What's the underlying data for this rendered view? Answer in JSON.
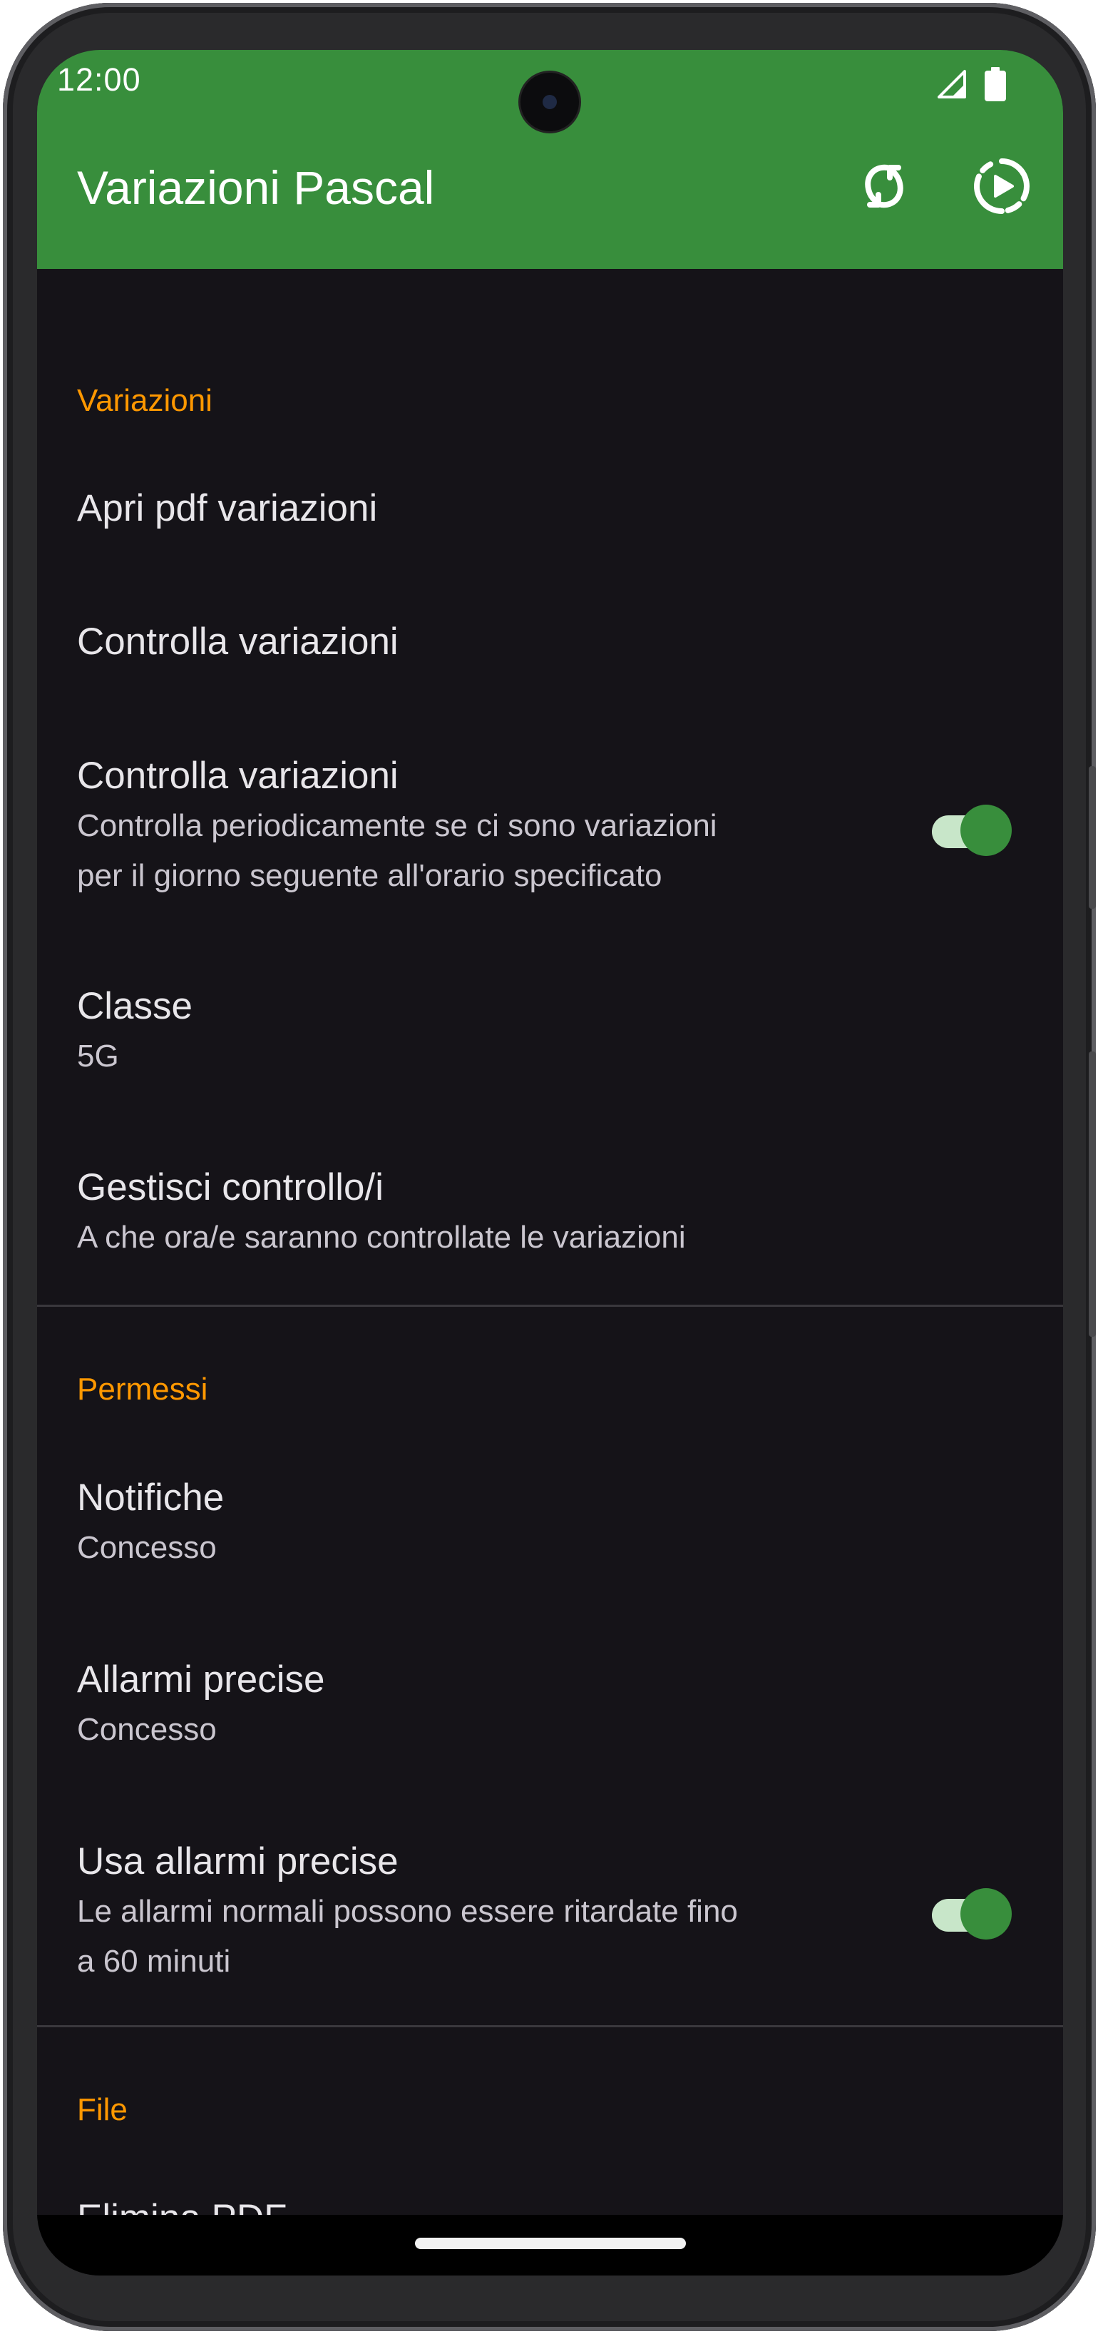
{
  "status_bar": {
    "time": "12:00"
  },
  "app_bar": {
    "title": "Variazioni Pascal",
    "actions": [
      {
        "icon": "sync-icon"
      },
      {
        "icon": "play-circle-dashed-icon"
      }
    ]
  },
  "colors": {
    "primary": "#388e3c",
    "accent": "#ff9800",
    "background": "#151318",
    "switch_track": "#c8e6c9"
  },
  "sections": [
    {
      "header": "Variazioni",
      "items": [
        {
          "title": "Apri pdf variazioni"
        },
        {
          "title": "Controlla variazioni"
        },
        {
          "title": "Controlla variazioni",
          "summary_line1": "Controlla periodicamente se ci sono variazioni",
          "summary_line2": "per il giorno seguente all'orario specificato",
          "switch_on": true
        },
        {
          "title": "Classe",
          "summary": "5G"
        },
        {
          "title": "Gestisci controllo/i",
          "summary": "A che ora/e saranno controllate le variazioni"
        }
      ]
    },
    {
      "header": "Permessi",
      "items": [
        {
          "title": "Notifiche",
          "summary": "Concesso"
        },
        {
          "title": "Allarmi precise",
          "summary": "Concesso"
        },
        {
          "title": "Usa allarmi precise",
          "summary_line1": "Le allarmi normali possono essere ritardate fino",
          "summary_line2": "a 60 minuti",
          "switch_on": true
        }
      ]
    },
    {
      "header": "File",
      "items": [
        {
          "title": "Elimina PDF"
        }
      ]
    }
  ]
}
